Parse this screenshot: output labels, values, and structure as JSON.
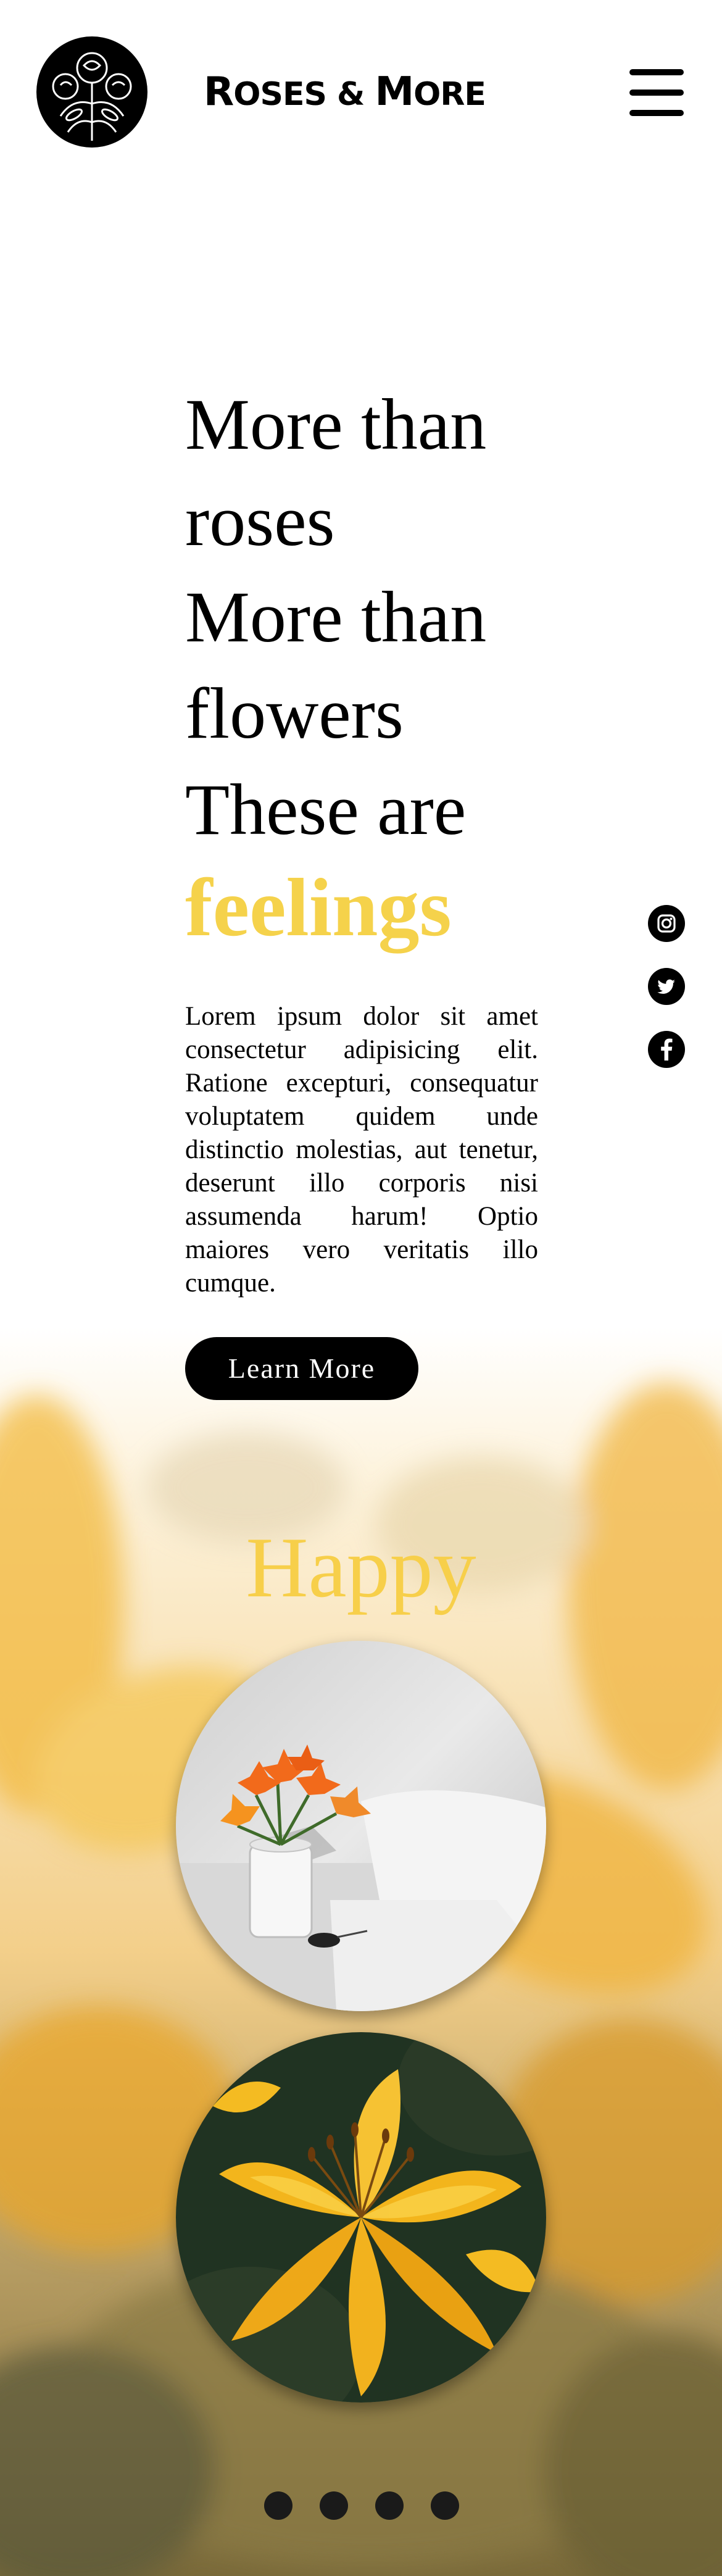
{
  "header": {
    "brand_first": "R",
    "brand_rest_1": "OSES & ",
    "brand_cap_2": "M",
    "brand_rest_2": "ORE",
    "logo_icon": "rose-emblem-icon",
    "menu_icon": "hamburger-menu-icon"
  },
  "hero": {
    "line1": "More than",
    "line2": "roses",
    "line3": "More than",
    "line4": "flowers",
    "line5": "These are",
    "accent_word": "feelings",
    "body": "Lorem ipsum dolor sit amet consectetur adipisicing elit. Ratione excepturi, consequatur voluptatem quidem unde distinctio molestias, aut tenetur, deserunt illo corporis nisi assumenda harum! Optio maiores vero veritatis illo cumque.",
    "cta_label": "Learn More"
  },
  "social": [
    {
      "icon": "instagram-icon"
    },
    {
      "icon": "twitter-icon"
    },
    {
      "icon": "facebook-icon"
    }
  ],
  "gallery": {
    "heading": "Happy",
    "images": [
      {
        "icon": "orange-lilies-vase-photo"
      },
      {
        "icon": "yellow-lilies-closeup-photo"
      }
    ],
    "dots_count": 4
  },
  "colors": {
    "accent_yellow": "#f5d24b",
    "happy_yellow": "#f7cf4a",
    "button_bg": "#000000",
    "button_text": "#ffffff"
  }
}
